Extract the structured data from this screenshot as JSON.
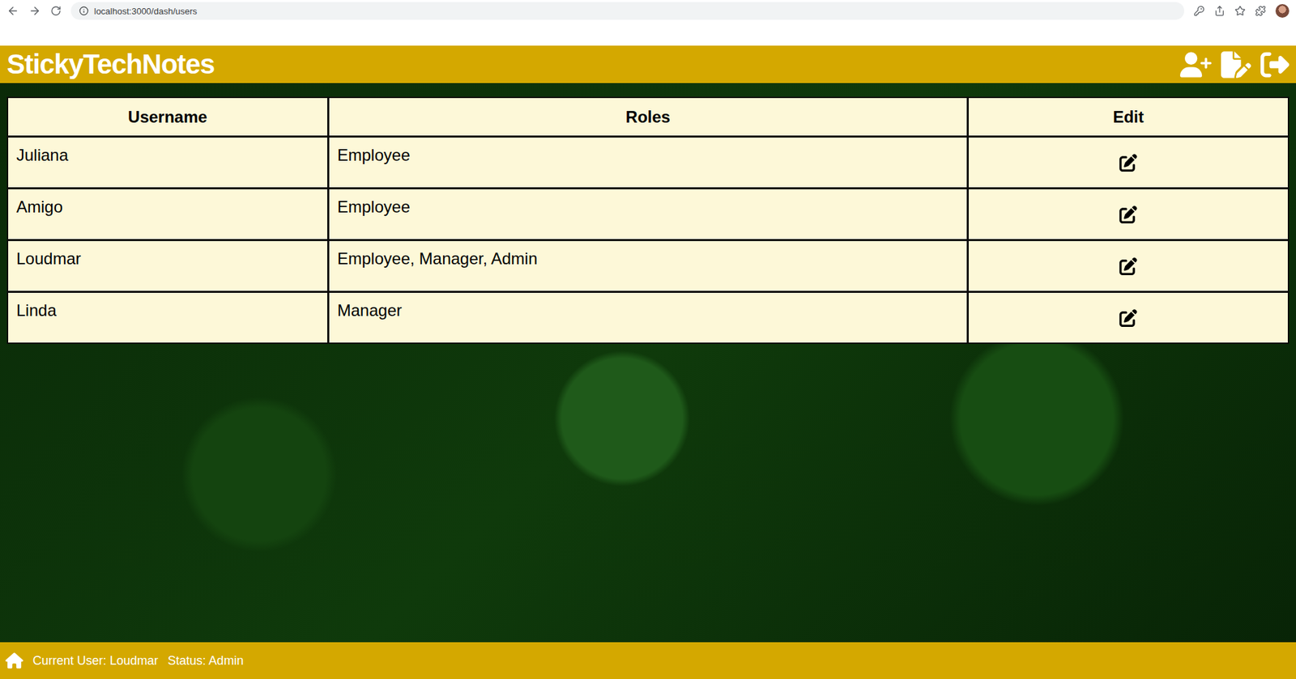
{
  "browser": {
    "url": "localhost:3000/dash/users"
  },
  "header": {
    "title": "StickyTechNotes"
  },
  "table": {
    "columns": [
      "Username",
      "Roles",
      "Edit"
    ],
    "rows": [
      {
        "username": "Juliana",
        "roles": "Employee"
      },
      {
        "username": "Amigo",
        "roles": "Employee"
      },
      {
        "username": "Loudmar",
        "roles": "Employee, Manager, Admin"
      },
      {
        "username": "Linda",
        "roles": "Manager"
      }
    ]
  },
  "status_bar": {
    "current_user": "Current User: Loudmar",
    "status": "Status: Admin"
  }
}
